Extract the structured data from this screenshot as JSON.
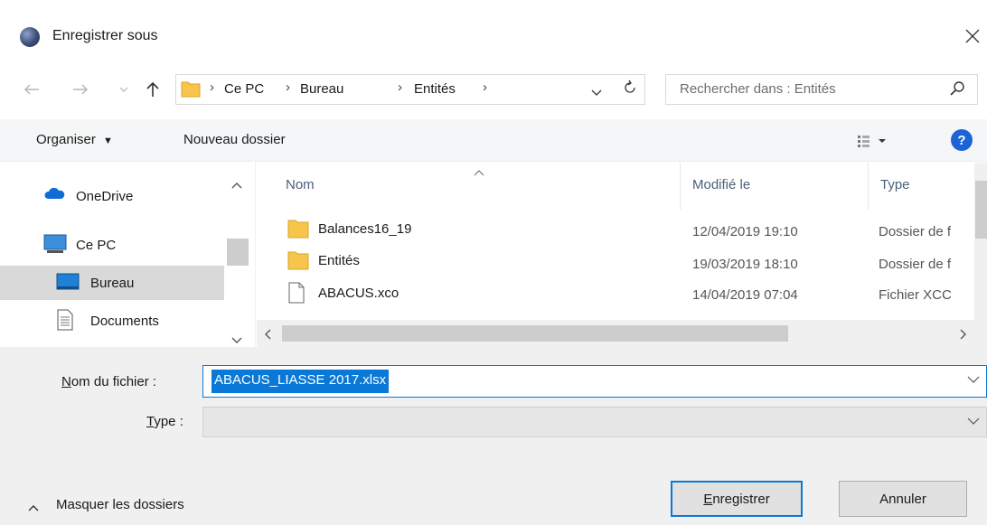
{
  "window": {
    "title": "Enregistrer sous"
  },
  "address": {
    "crumbs": [
      "Ce PC",
      "Bureau",
      "Entités"
    ]
  },
  "search": {
    "placeholder": "Rechercher dans : Entités"
  },
  "toolbar": {
    "organize_label": "Organiser",
    "new_folder_label": "Nouveau dossier"
  },
  "nav": {
    "items": [
      {
        "label": "OneDrive"
      },
      {
        "label": "Ce PC"
      },
      {
        "label": "Bureau"
      },
      {
        "label": "Documents"
      }
    ]
  },
  "files": {
    "columns": {
      "name": "Nom",
      "modified": "Modifié le",
      "type": "Type"
    },
    "rows": [
      {
        "name": "Balances16_19",
        "modified": "12/04/2019 19:10",
        "type": "Dossier de f"
      },
      {
        "name": "Entités",
        "modified": "19/03/2019 18:10",
        "type": "Dossier de f"
      },
      {
        "name": "ABACUS.xco",
        "modified": "14/04/2019 07:04",
        "type": "Fichier XCC"
      }
    ]
  },
  "form": {
    "filename_label_first": "N",
    "filename_label_rest": "om du fichier :",
    "filename_value": "ABACUS_LIASSE 2017.xlsx",
    "type_label_first": "T",
    "type_label_rest": "ype :",
    "type_value": ""
  },
  "footer": {
    "hide_folders_label": "Masquer les dossiers",
    "save_first": "E",
    "save_rest": "nregistrer",
    "cancel_label": "Annuler"
  },
  "colors": {
    "accent": "#0a78d7",
    "folder": "#f7c54a",
    "help": "#1c64d6"
  }
}
